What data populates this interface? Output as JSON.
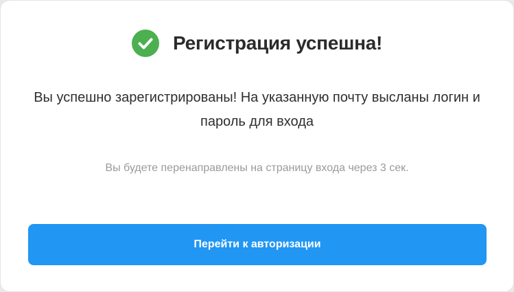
{
  "dialog": {
    "title": "Регистрация успешна!",
    "icon": "check-circle-icon",
    "icon_color": "#4caf50",
    "message": "Вы успешно зарегистрированы! На указанную почту высланы логин и пароль для входа",
    "redirect_note": "Вы будете перенаправлены на страницу входа через 3 сек.",
    "button_label": "Перейти к авторизации",
    "accent_color": "#2196f3"
  }
}
